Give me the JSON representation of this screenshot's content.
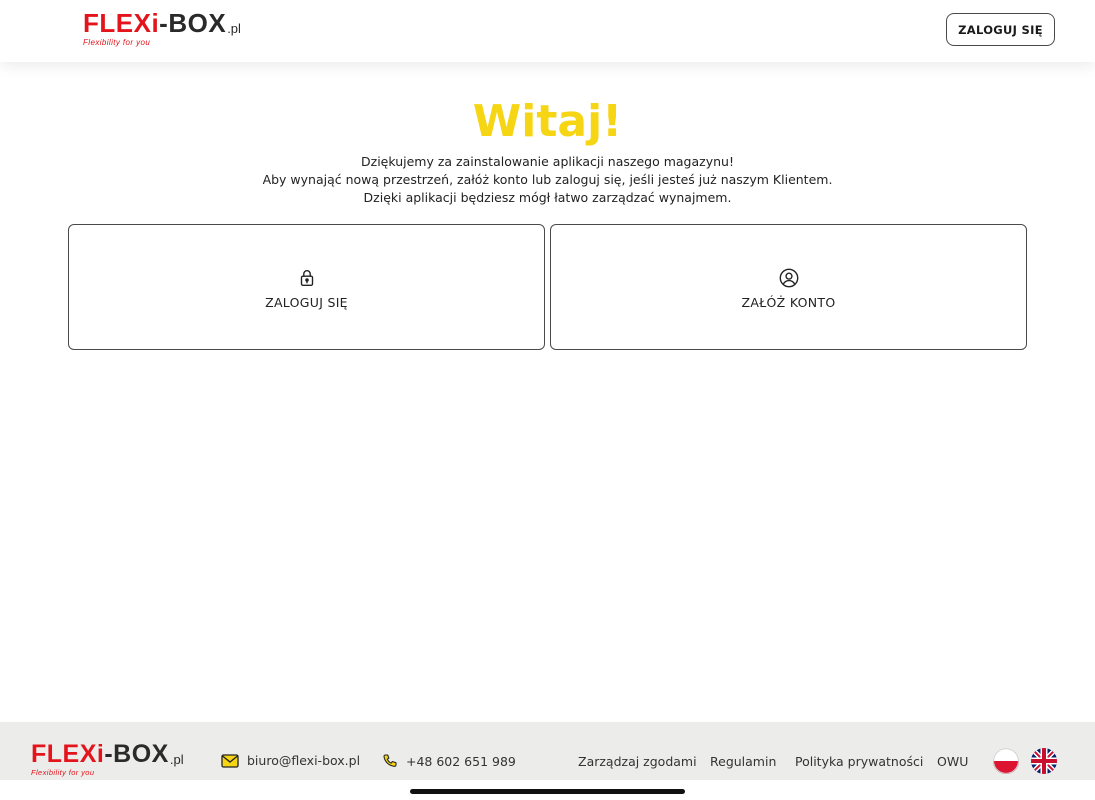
{
  "header": {
    "logo": {
      "brand_part1": "FLEXi",
      "brand_dash": "-",
      "brand_part2": "BOX",
      "brand_domain": ".pl",
      "tagline": "Flexibility for you"
    },
    "login_button_label": "ZALOGUJ SIĘ"
  },
  "main": {
    "title": "Witaj!",
    "intro_lines": [
      "Dziękujemy za zainstalowanie aplikacji naszego magazynu!",
      "Aby wynająć nową przestrzeń, załóż konto lub zaloguj się, jeśli jesteś już naszym Klientem.",
      "Dzięki aplikacji będziesz mógł łatwo zarządzać wynajmem."
    ],
    "cards": [
      {
        "label": "ZALOGUJ SIĘ",
        "icon": "lock-icon"
      },
      {
        "label": "ZAŁÓŻ KONTO",
        "icon": "user-circle-icon"
      }
    ]
  },
  "footer": {
    "logo": {
      "brand_part1": "FLEXi",
      "brand_dash": "-",
      "brand_part2": "BOX",
      "brand_domain": ".pl",
      "tagline": "Flexibility for you"
    },
    "email": "biuro@flexi-box.pl",
    "phone": "+48 602 651 989",
    "links": [
      "Zarządzaj zgodami",
      "Regulamin",
      "Polityka prywatności",
      "OWU"
    ],
    "languages": [
      {
        "code": "pl",
        "icon": "poland-flag-icon"
      },
      {
        "code": "en",
        "icon": "uk-flag-icon"
      }
    ]
  },
  "colors": {
    "brand_red": "#e3141b",
    "brand_dark": "#2a2a2a",
    "accent_yellow": "#f6d514",
    "footer_bg": "#ececea"
  }
}
